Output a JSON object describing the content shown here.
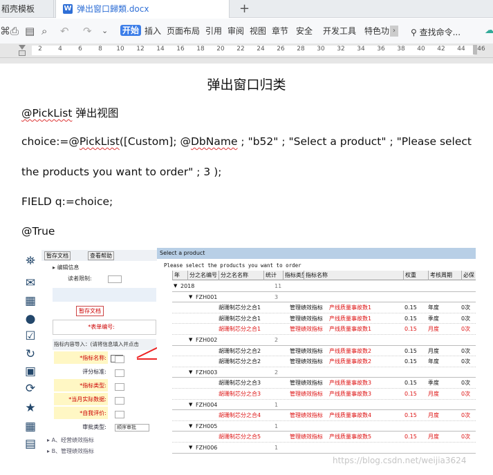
{
  "tabs": {
    "inactive_label": "稻壳模板",
    "active_label": "弹出窗口歸類.docx"
  },
  "toolbar": {
    "menus": [
      "开始",
      "插入",
      "页面布局",
      "引用",
      "审阅",
      "视图",
      "章节",
      "安全",
      "开发工具",
      "特色功"
    ],
    "search_label": "查找命令..."
  },
  "ruler": {
    "ticks": [
      "2",
      "4",
      "6",
      "8",
      "10",
      "12",
      "14",
      "16",
      "18",
      "20",
      "22",
      "24",
      "26",
      "28",
      "30",
      "32",
      "34",
      "36",
      "38",
      "40",
      "42",
      "44",
      "46"
    ]
  },
  "document": {
    "title": "弹出窗口归类",
    "p1_prefix": "@PickList",
    "p1_suffix": " 弹出视图",
    "p2_a": "choice:=@",
    "p2_b": "PickList",
    "p2_c": "([Custom]; @",
    "p2_d": "DbName",
    "p2_e": " ; \"b52\" ; \"Select a product\" ; \"Please select",
    "p3": "the products you want to order\" ; 3 );",
    "p4": "FIELD q:=choice;",
    "p5": "@True"
  },
  "form": {
    "btn_save": "暂存文档",
    "btn_help": "查看帮助",
    "edit_info": "编辑信息",
    "reader_field": "读者限制:",
    "draft_btn": "暂存文档",
    "form_no": "*表单编号:",
    "section_title": "指标内容导入：(请将信息填入并点击",
    "labels": [
      "*指标名称:",
      "评分标准:",
      "*指标类型:",
      "*当月实际数据:",
      "*自我评价:",
      "审批类型:"
    ],
    "approval_value": "顺序审批",
    "sec_a": "A、经营绩效指标",
    "sec_b": "B、管理绩效指标"
  },
  "dialog": {
    "title": "Select a product",
    "message": "Please select the products you want to order",
    "columns": [
      "年",
      "分之名编号",
      "分之名名称",
      "统计",
      "指标类型",
      "指标名称",
      "权重",
      "考核周期",
      "必保"
    ],
    "rows": [
      {
        "kind": "group",
        "label": "2018",
        "count": "11",
        "level": 0
      },
      {
        "kind": "group",
        "label": "FZH001",
        "count": "3",
        "level": 1
      },
      {
        "kind": "data",
        "color": "blk",
        "name": "胡珊制芯分之合1",
        "type": "管理绩效指标",
        "metric": "产线质量事故数1",
        "weight": "0.15",
        "period": "年度",
        "req": "0次"
      },
      {
        "kind": "data",
        "color": "blk",
        "name": "胡珊制芯分之合1",
        "type": "管理绩效指标",
        "metric": "产线质量事故数1",
        "weight": "0.15",
        "period": "季度",
        "req": "0次"
      },
      {
        "kind": "data",
        "color": "red",
        "name": "胡珊制芯分之合1",
        "type": "管理绩效指标",
        "metric": "产线质量事故数1",
        "weight": "0.15",
        "period": "月度",
        "req": "0次"
      },
      {
        "kind": "group",
        "label": "FZH002",
        "count": "2",
        "level": 1
      },
      {
        "kind": "data",
        "color": "blk",
        "name": "胡珊制芯分之合2",
        "type": "管理绩效指标",
        "metric": "产线质量事故数2",
        "weight": "0.15",
        "period": "月度",
        "req": "0次"
      },
      {
        "kind": "data",
        "color": "blk",
        "name": "胡珊制芯分之合2",
        "type": "管理绩效指标",
        "metric": "产线质量事故数2",
        "weight": "0.15",
        "period": "年度",
        "req": "0次"
      },
      {
        "kind": "group",
        "label": "FZH003",
        "count": "2",
        "level": 1
      },
      {
        "kind": "data",
        "color": "blk",
        "name": "胡珊制芯分之合3",
        "type": "管理绩效指标",
        "metric": "产线质量事故数3",
        "weight": "0.15",
        "period": "季度",
        "req": "0次"
      },
      {
        "kind": "data",
        "color": "red",
        "name": "胡珊制芯分之合3",
        "type": "管理绩效指标",
        "metric": "产线质量事故数3",
        "weight": "0.15",
        "period": "月度",
        "req": "0次"
      },
      {
        "kind": "group",
        "label": "FZH004",
        "count": "1",
        "level": 1
      },
      {
        "kind": "data",
        "color": "red",
        "name": "胡珊制芯分之合4",
        "type": "管理绩效指标",
        "metric": "产线质量事故数4",
        "weight": "0.15",
        "period": "月度",
        "req": "0次"
      },
      {
        "kind": "group",
        "label": "FZH005",
        "count": "1",
        "level": 1
      },
      {
        "kind": "data",
        "color": "red",
        "name": "胡珊制芯分之合5",
        "type": "管理绩效指标",
        "metric": "产线质量事故数5",
        "weight": "0.15",
        "period": "月度",
        "req": "0次"
      },
      {
        "kind": "group",
        "label": "FZH006",
        "count": "1",
        "level": 1
      }
    ]
  },
  "watermark": "https://blog.csdn.net/weijia3624"
}
